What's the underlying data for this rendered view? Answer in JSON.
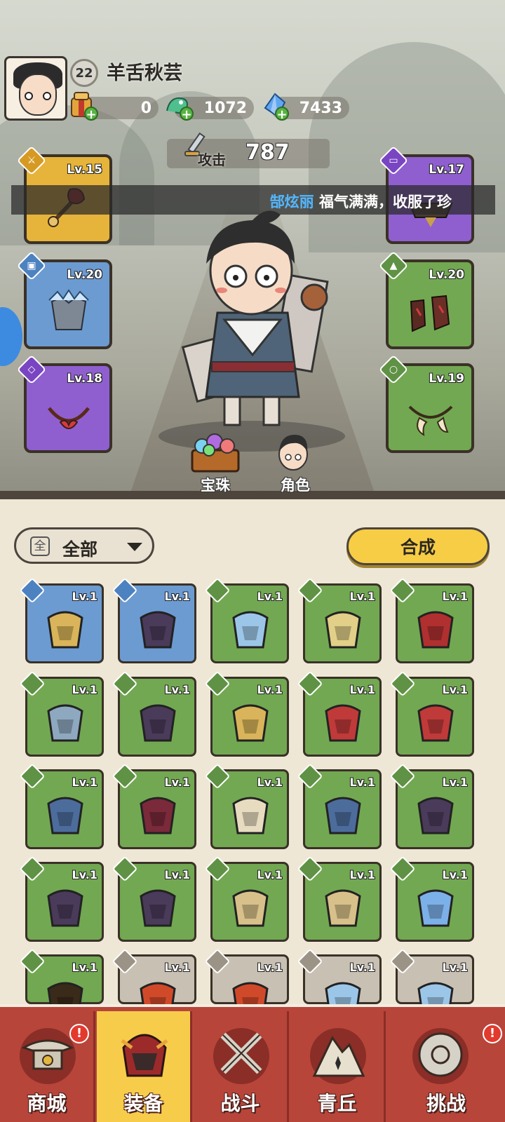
{
  "player": {
    "name": "羊舌秋芸",
    "level": "22"
  },
  "resources": [
    {
      "name": "gift-pack",
      "value": "0"
    },
    {
      "name": "jade-dragon",
      "value": "1072"
    },
    {
      "name": "crystal",
      "value": "7433"
    }
  ],
  "attack": {
    "label": "攻击",
    "value": "787"
  },
  "marquee": {
    "name": "郜炫丽",
    "message": "福气满满，收服了珍"
  },
  "equipped": {
    "top_left": {
      "level": "Lv.15",
      "slot": "weapon"
    },
    "mid_left": {
      "level": "Lv.20",
      "slot": "armor"
    },
    "low_left": {
      "level": "Lv.18",
      "slot": "necklace"
    },
    "top_right": {
      "level": "Lv.17",
      "slot": "belt"
    },
    "mid_right": {
      "level": "Lv.20",
      "slot": "boots"
    },
    "low_right": {
      "level": "Lv.19",
      "slot": "ring"
    }
  },
  "sub_buttons": {
    "orbs": "宝珠",
    "role": "角色"
  },
  "filter": {
    "box": "全",
    "label": "全部"
  },
  "merge_label": "合成",
  "items": [
    {
      "level": "Lv.1",
      "color": "blue"
    },
    {
      "level": "Lv.1",
      "color": "blue"
    },
    {
      "level": "Lv.1",
      "color": "green"
    },
    {
      "level": "Lv.1",
      "color": "green"
    },
    {
      "level": "Lv.1",
      "color": "green"
    },
    {
      "level": "Lv.1",
      "color": "green"
    },
    {
      "level": "Lv.1",
      "color": "green"
    },
    {
      "level": "Lv.1",
      "color": "green"
    },
    {
      "level": "Lv.1",
      "color": "green"
    },
    {
      "level": "Lv.1",
      "color": "green"
    },
    {
      "level": "Lv.1",
      "color": "green"
    },
    {
      "level": "Lv.1",
      "color": "green"
    },
    {
      "level": "Lv.1",
      "color": "green"
    },
    {
      "level": "Lv.1",
      "color": "green"
    },
    {
      "level": "Lv.1",
      "color": "green"
    },
    {
      "level": "Lv.1",
      "color": "green"
    },
    {
      "level": "Lv.1",
      "color": "green"
    },
    {
      "level": "Lv.1",
      "color": "green"
    },
    {
      "level": "Lv.1",
      "color": "green"
    },
    {
      "level": "Lv.1",
      "color": "green"
    },
    {
      "level": "Lv.1",
      "color": "green"
    },
    {
      "level": "Lv.1",
      "color": "gray"
    },
    {
      "level": "Lv.1",
      "color": "gray"
    },
    {
      "level": "Lv.1",
      "color": "gray"
    },
    {
      "level": "Lv.1",
      "color": "gray"
    }
  ],
  "tabs": [
    {
      "label": "商城",
      "badge": "!"
    },
    {
      "label": "装备",
      "badge": ""
    },
    {
      "label": "战斗",
      "badge": ""
    },
    {
      "label": "青丘",
      "badge": ""
    },
    {
      "label": "挑战",
      "badge": "!"
    }
  ],
  "colors": {
    "item_green": "#72a852",
    "item_blue": "#6c9bd2",
    "item_gray": "#c9c0b4",
    "tab_bar": "#b8453a",
    "tab_active": "#f7cc4a",
    "accent_yellow": "#f7cd45"
  }
}
